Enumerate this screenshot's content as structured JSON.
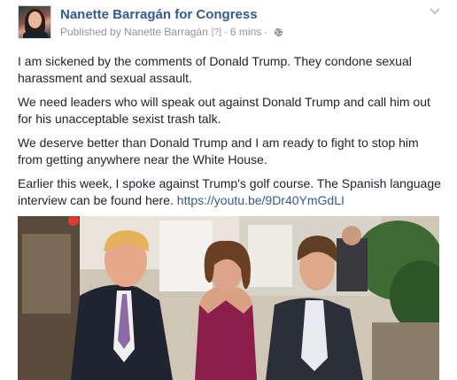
{
  "post": {
    "page_name": "Nanette Barragán for Congress",
    "meta": {
      "published_by": "Published by Nanette Barragán",
      "info_marker": "[?]",
      "separator": "·",
      "time": "6 mins",
      "privacy_icon": "globe-icon",
      "menu_icon": "chevron-down-icon"
    },
    "paragraphs": [
      "I am sickened by the comments of Donald Trump. They condone sexual harassment and sexual assault.",
      "We need leaders who will speak out against Donald Trump and call him out for his unacceptable sexist trash talk.",
      "We deserve better than Donald Trump and I am ready to fight to stop him from getting anywhere near the White House."
    ],
    "last_paragraph": {
      "text": "Earlier this week, I spoke against Trump's golf course. The Spanish language interview can be found here. ",
      "link": "https://youtu.be/9Dr40YmGdLI"
    }
  },
  "colors": {
    "link": "#365899",
    "meta": "#90949c",
    "text": "#1d2129"
  }
}
